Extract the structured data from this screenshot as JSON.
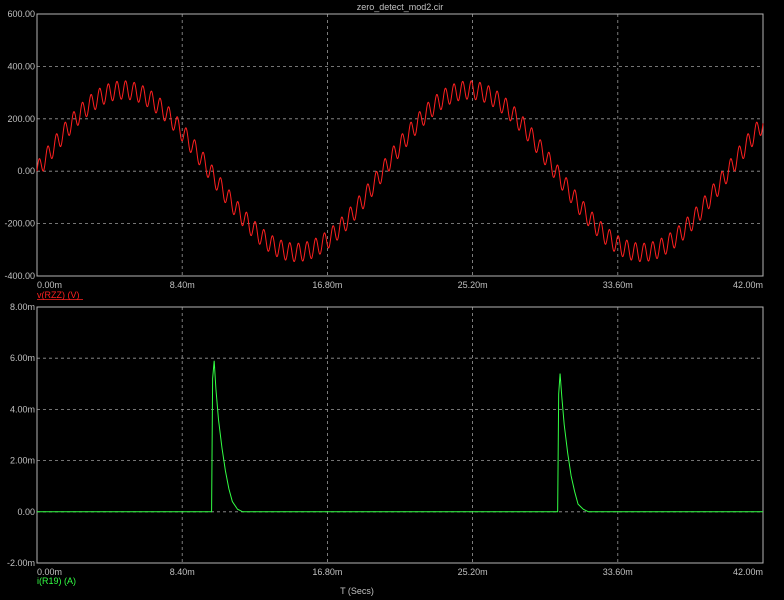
{
  "title": "zero_detect_mod2.cir",
  "x_axis_title": "T (Secs)",
  "colors": {
    "background": "#000000",
    "frame": "#b4b4b4",
    "grid": "#9a9a9a",
    "text": "#c0c0c0",
    "trace_voltage": "#ff2020",
    "trace_current": "#33ff44"
  },
  "chart_data": [
    {
      "type": "line",
      "series": [
        {
          "name": "v(RZZ) (V)",
          "amplitude": 310,
          "frequency_hz": 50,
          "ripple_amplitude": 35,
          "ripple_period_s": 0.0005,
          "waveform": "sine"
        }
      ],
      "x_ticks": [
        "0.00m",
        "8.40m",
        "16.80m",
        "25.20m",
        "33.60m",
        "42.00m"
      ],
      "y_ticks": [
        "600.00",
        "400.00",
        "200.00",
        "0.00",
        "-200.00",
        "-400.00"
      ],
      "xlim": [
        0,
        0.042
      ],
      "ylim": [
        -400,
        600
      ],
      "grid": true
    },
    {
      "type": "line",
      "series": [
        {
          "name": "i(R19) (A)",
          "points": [
            [
              0,
              0
            ],
            [
              0.0099,
              0
            ],
            [
              0.0101,
              0
            ],
            [
              0.01016,
              0.0052
            ],
            [
              0.01025,
              0.0059
            ],
            [
              0.01035,
              0.0048
            ],
            [
              0.0105,
              0.0036
            ],
            [
              0.0107,
              0.0025
            ],
            [
              0.0109,
              0.0016
            ],
            [
              0.0111,
              0.0009
            ],
            [
              0.0113,
              0.0004
            ],
            [
              0.0116,
              0.0001
            ],
            [
              0.0119,
              0
            ],
            [
              0.0299,
              0
            ],
            [
              0.03012,
              0
            ],
            [
              0.03018,
              0.0046
            ],
            [
              0.03026,
              0.0054
            ],
            [
              0.03036,
              0.0045
            ],
            [
              0.0305,
              0.0034
            ],
            [
              0.0307,
              0.0023
            ],
            [
              0.0309,
              0.0014
            ],
            [
              0.0311,
              0.0008
            ],
            [
              0.0313,
              0.0003
            ],
            [
              0.0316,
              0.0001
            ],
            [
              0.0319,
              0
            ],
            [
              0.042,
              0
            ]
          ]
        }
      ],
      "x_ticks": [
        "0.00m",
        "8.40m",
        "16.80m",
        "25.20m",
        "33.60m",
        "42.00m"
      ],
      "y_ticks": [
        "8.00m",
        "6.00m",
        "4.00m",
        "2.00m",
        "0.00",
        "-2.00m"
      ],
      "xlim": [
        0,
        0.042
      ],
      "ylim": [
        -0.002,
        0.008
      ],
      "grid": true
    }
  ]
}
